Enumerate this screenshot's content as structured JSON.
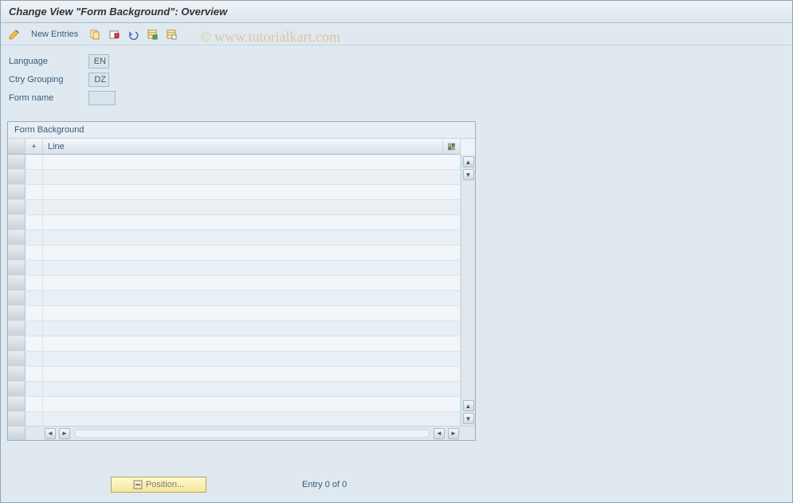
{
  "title": "Change View \"Form Background\": Overview",
  "toolbar": {
    "new_entries_label": "New Entries"
  },
  "watermark": "© www.tutorialkart.com",
  "form": {
    "language_label": "Language",
    "language_value": "EN",
    "ctry_grouping_label": "Ctry Grouping",
    "ctry_grouping_value": "DZ",
    "form_name_label": "Form name",
    "form_name_value": ""
  },
  "table": {
    "title": "Form Background",
    "col_plus": "+",
    "col_line": "Line",
    "rows": [
      "",
      "",
      "",
      "",
      "",
      "",
      "",
      "",
      "",
      "",
      "",
      "",
      "",
      "",
      "",
      "",
      "",
      ""
    ]
  },
  "footer": {
    "position_label": "Position...",
    "entry_status": "Entry 0 of 0"
  }
}
